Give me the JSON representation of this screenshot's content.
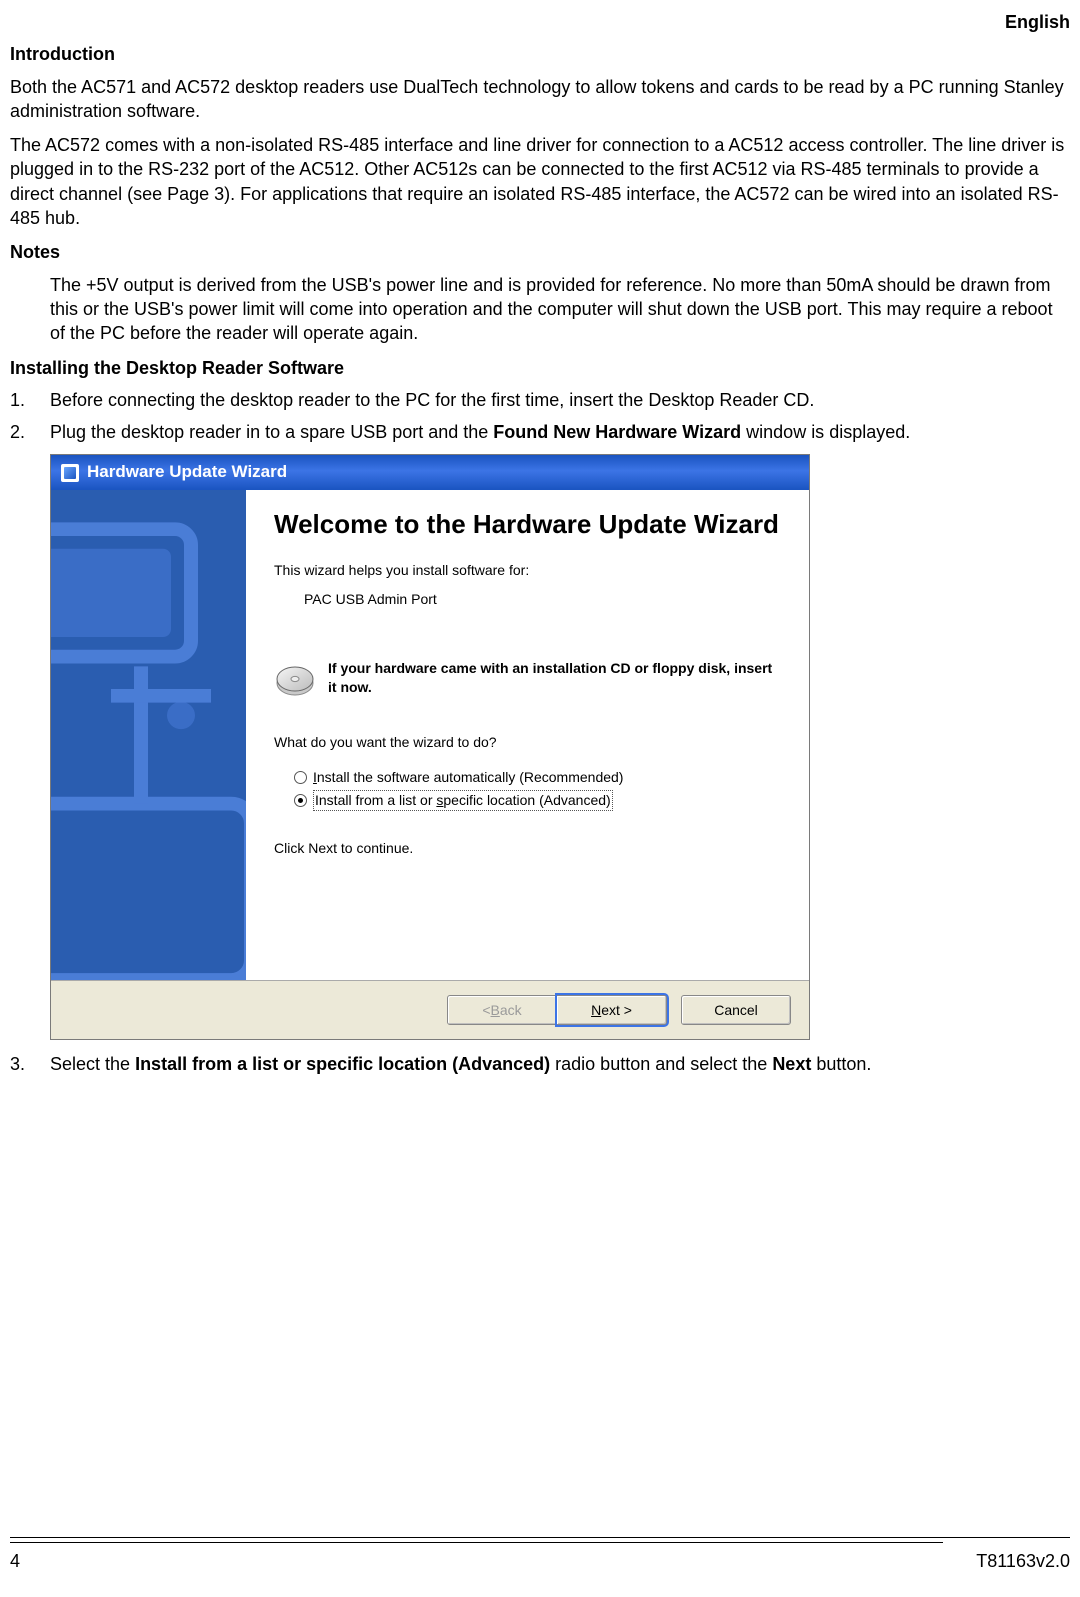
{
  "header": {
    "language": "English"
  },
  "intro": {
    "heading": "Introduction",
    "p1": "Both the AC571 and AC572 desktop readers use DualTech technology to allow tokens and cards to be read by a PC running Stanley administration software.",
    "p2": "The AC572 comes with a non-isolated RS-485 interface and line driver for connection to a AC512 access controller. The line driver is plugged in to the RS-232 port of the AC512. Other AC512s can be connected to the first AC512 via RS-485 terminals to provide a direct channel (see Page 3). For applications that require an isolated RS-485 interface, the AC572 can be wired into an isolated RS-485 hub."
  },
  "notes": {
    "heading": "Notes",
    "body": "The +5V output is derived from the USB's power line and is provided for reference. No more than 50mA should be drawn from this or the USB's power limit will come into operation and the computer will shut down the USB port. This may require a reboot of the PC before the reader will operate again."
  },
  "install": {
    "heading": "Installing the Desktop Reader Software",
    "steps": {
      "s1": "Before connecting the desktop reader to the PC for the first time, insert the Desktop Reader CD.",
      "s2_before": "Plug the desktop reader in to a spare USB port and the ",
      "s2_bold": "Found New Hardware Wizard",
      "s2_after": " window is displayed.",
      "s3_before": "Select the ",
      "s3_bold1": "Install from a list or specific location (Advanced)",
      "s3_mid": " radio button and select the ",
      "s3_bold2": "Next",
      "s3_after": " button."
    }
  },
  "wizard": {
    "titlebar": "Hardware Update Wizard",
    "heading": "Welcome to the Hardware Update Wizard",
    "sub": "This wizard helps you install software for:",
    "device": "PAC USB Admin Port",
    "cd_text": "If your hardware came with an installation CD or floppy disk, insert it now.",
    "question": "What do you want the wizard to do?",
    "opt1": "Install the software automatically (Recommended)",
    "opt2": "Install from a list or specific location (Advanced)",
    "continue": "Click Next to continue.",
    "btn_back": "< Back",
    "btn_next": "Next >",
    "btn_cancel": "Cancel"
  },
  "footer": {
    "page": "4",
    "docref": "T81163v2.0"
  }
}
